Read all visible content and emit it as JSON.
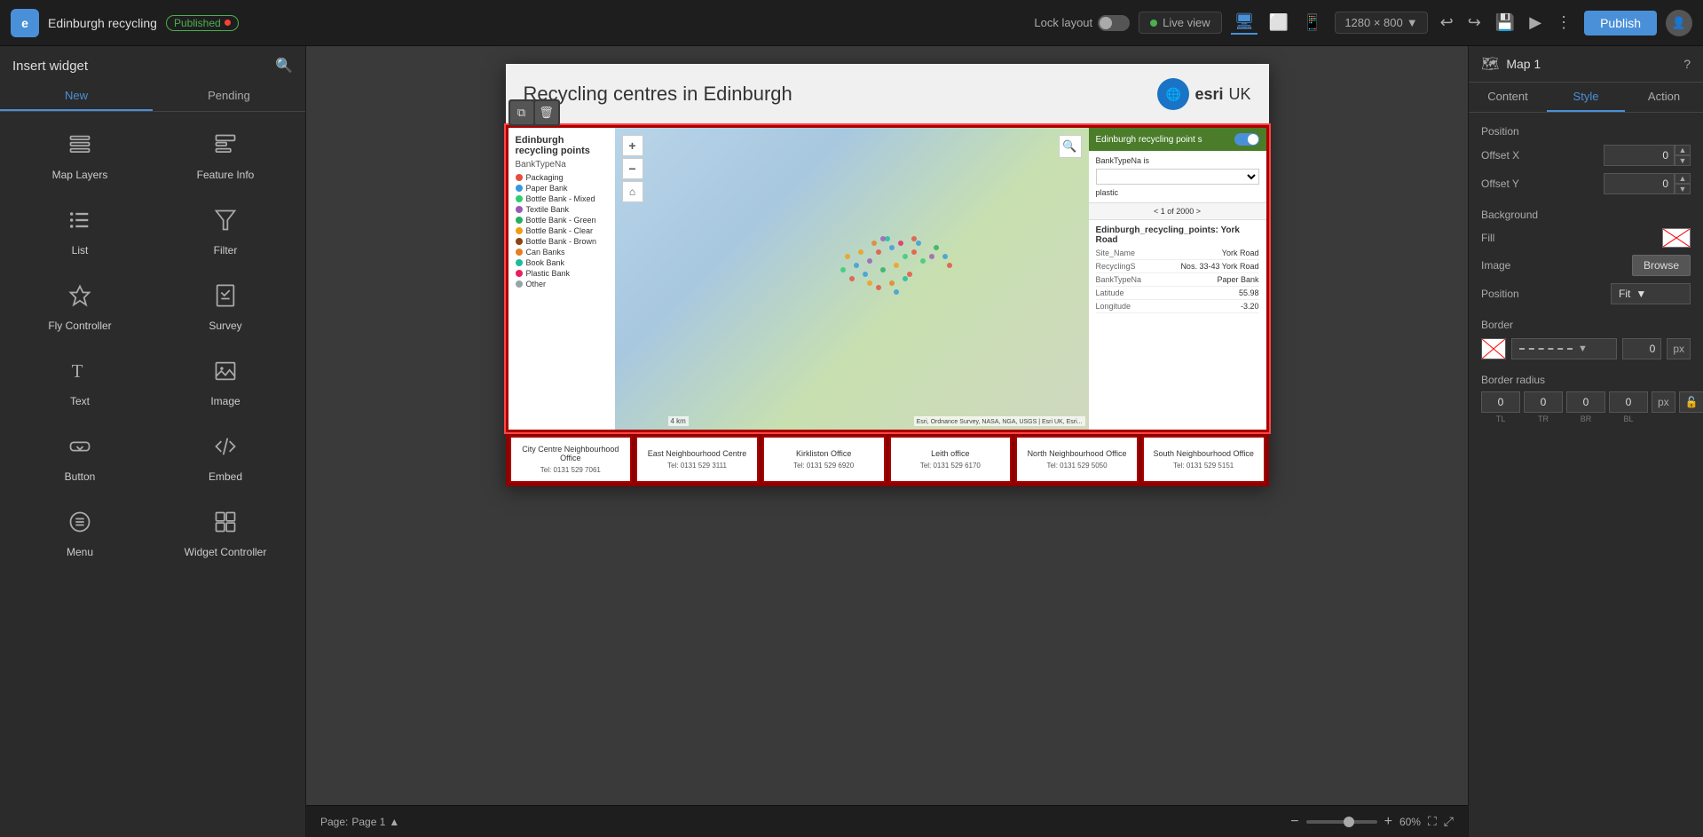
{
  "topbar": {
    "app_title": "Edinburgh recycling",
    "published_label": "Published",
    "lock_layout_label": "Lock layout",
    "live_view_label": "Live view",
    "resolution": "1280 × 800",
    "publish_label": "Publish"
  },
  "sidebar": {
    "title": "Insert widget",
    "tab_new": "New",
    "tab_pending": "Pending",
    "widgets": [
      {
        "name": "map-layers",
        "label": "Map Layers"
      },
      {
        "name": "feature-info",
        "label": "Feature Info"
      },
      {
        "name": "list",
        "label": "List"
      },
      {
        "name": "filter",
        "label": "Filter"
      },
      {
        "name": "fly-controller",
        "label": "Fly Controller"
      },
      {
        "name": "survey",
        "label": "Survey"
      },
      {
        "name": "text",
        "label": "Text"
      },
      {
        "name": "image",
        "label": "Image"
      },
      {
        "name": "button",
        "label": "Button"
      },
      {
        "name": "embed",
        "label": "Embed"
      },
      {
        "name": "menu",
        "label": "Menu"
      },
      {
        "name": "widget-controller",
        "label": "Widget Controller"
      }
    ]
  },
  "canvas": {
    "story_title": "Recycling centres in Edinburgh",
    "esri_label": "UK"
  },
  "legend": {
    "title": "Edinburgh recycling points",
    "subtitle": "BankTypeNa",
    "items": [
      {
        "label": "Packaging",
        "color": "#e74c3c"
      },
      {
        "label": "Paper Bank",
        "color": "#3498db"
      },
      {
        "label": "Bottle Bank - Mixed",
        "color": "#2ecc71"
      },
      {
        "label": "Textile Bank",
        "color": "#9b59b6"
      },
      {
        "label": "Bottle Bank - Green",
        "color": "#27ae60"
      },
      {
        "label": "Bottle Bank - Clear",
        "color": "#f39c12"
      },
      {
        "label": "Bottle Bank - Brown",
        "color": "#8B4513"
      },
      {
        "label": "Can Banks",
        "color": "#e67e22"
      },
      {
        "label": "Book Bank",
        "color": "#1abc9c"
      },
      {
        "label": "Plastic Bank",
        "color": "#e91e63"
      },
      {
        "label": "Other",
        "color": "#95a5a6"
      }
    ]
  },
  "info_panel": {
    "layer_name": "Edinburgh recycling point s",
    "filter_label": "BankTypeNa is",
    "filter_value": "plastic",
    "nav_text": "< 1 of 2000 >",
    "feature_title": "Edinburgh_recycling_points: York Road",
    "rows": [
      {
        "key": "Site_Name",
        "val": "York Road"
      },
      {
        "key": "RecyclingS",
        "val": "Nos. 33-43 York Road"
      },
      {
        "key": "BankTypeNa",
        "val": "Paper Bank"
      },
      {
        "key": "Latitude",
        "val": "55.98"
      },
      {
        "key": "Longitude",
        "val": "-3.20"
      }
    ]
  },
  "offices": [
    {
      "name": "City Centre Neighbourhood Office",
      "tel": "Tel: 0131 529 7061"
    },
    {
      "name": "East Neighbourhood Centre",
      "tel": "Tel: 0131 529 3111"
    },
    {
      "name": "Kirkliston Office",
      "tel": "Tel: 0131 529 6920"
    },
    {
      "name": "Leith office",
      "tel": "Tel: 0131 529 6170"
    },
    {
      "name": "North Neighbourhood Office",
      "tel": "Tel: 0131 529 5050"
    },
    {
      "name": "South Neighbourhood Office",
      "tel": "Tel: 0131 529 5151"
    }
  ],
  "right_panel": {
    "title": "Map 1",
    "tab_content": "Content",
    "tab_style": "Style",
    "tab_action": "Action",
    "position_section": "Position",
    "offset_x_label": "Offset X",
    "offset_x_val": "0",
    "offset_y_label": "Offset Y",
    "offset_y_val": "0",
    "background_section": "Background",
    "fill_label": "Fill",
    "image_label": "Image",
    "browse_label": "Browse",
    "position_label": "Position",
    "position_val": "Fit",
    "border_section": "Border",
    "border_radius_section": "Border radius",
    "border_width_val": "0",
    "border_unit": "px",
    "br_tl": "0",
    "br_tr": "0",
    "br_br": "0",
    "br_bl": "0",
    "br_tl_label": "TL",
    "br_tr_label": "TR",
    "br_br_label": "BR",
    "br_bl_label": "BL",
    "br_unit": "px"
  },
  "bottombar": {
    "page_label": "Page:",
    "page_name": "Page 1",
    "zoom_level": "60%"
  },
  "map": {
    "scale_label": "4 km",
    "attrib": "Esri, Ordnance Survey, NASA, NGA, USGS | Esri UK, Esri...",
    "search_placeholder": "Search"
  }
}
